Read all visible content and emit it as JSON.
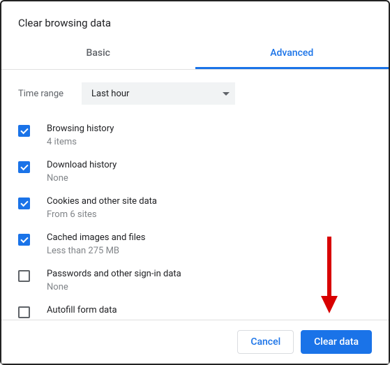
{
  "title": "Clear browsing data",
  "tabs": {
    "basic": "Basic",
    "advanced": "Advanced",
    "active": "advanced"
  },
  "time": {
    "label": "Time range",
    "value": "Last hour"
  },
  "items": [
    {
      "title": "Browsing history",
      "sub": "4 items",
      "checked": true
    },
    {
      "title": "Download history",
      "sub": "None",
      "checked": true
    },
    {
      "title": "Cookies and other site data",
      "sub": "From 6 sites",
      "checked": true
    },
    {
      "title": "Cached images and files",
      "sub": "Less than 275 MB",
      "checked": true
    },
    {
      "title": "Passwords and other sign-in data",
      "sub": "None",
      "checked": false
    },
    {
      "title": "Autofill form data",
      "sub": "",
      "checked": false
    }
  ],
  "buttons": {
    "cancel": "Cancel",
    "clear": "Clear data"
  }
}
